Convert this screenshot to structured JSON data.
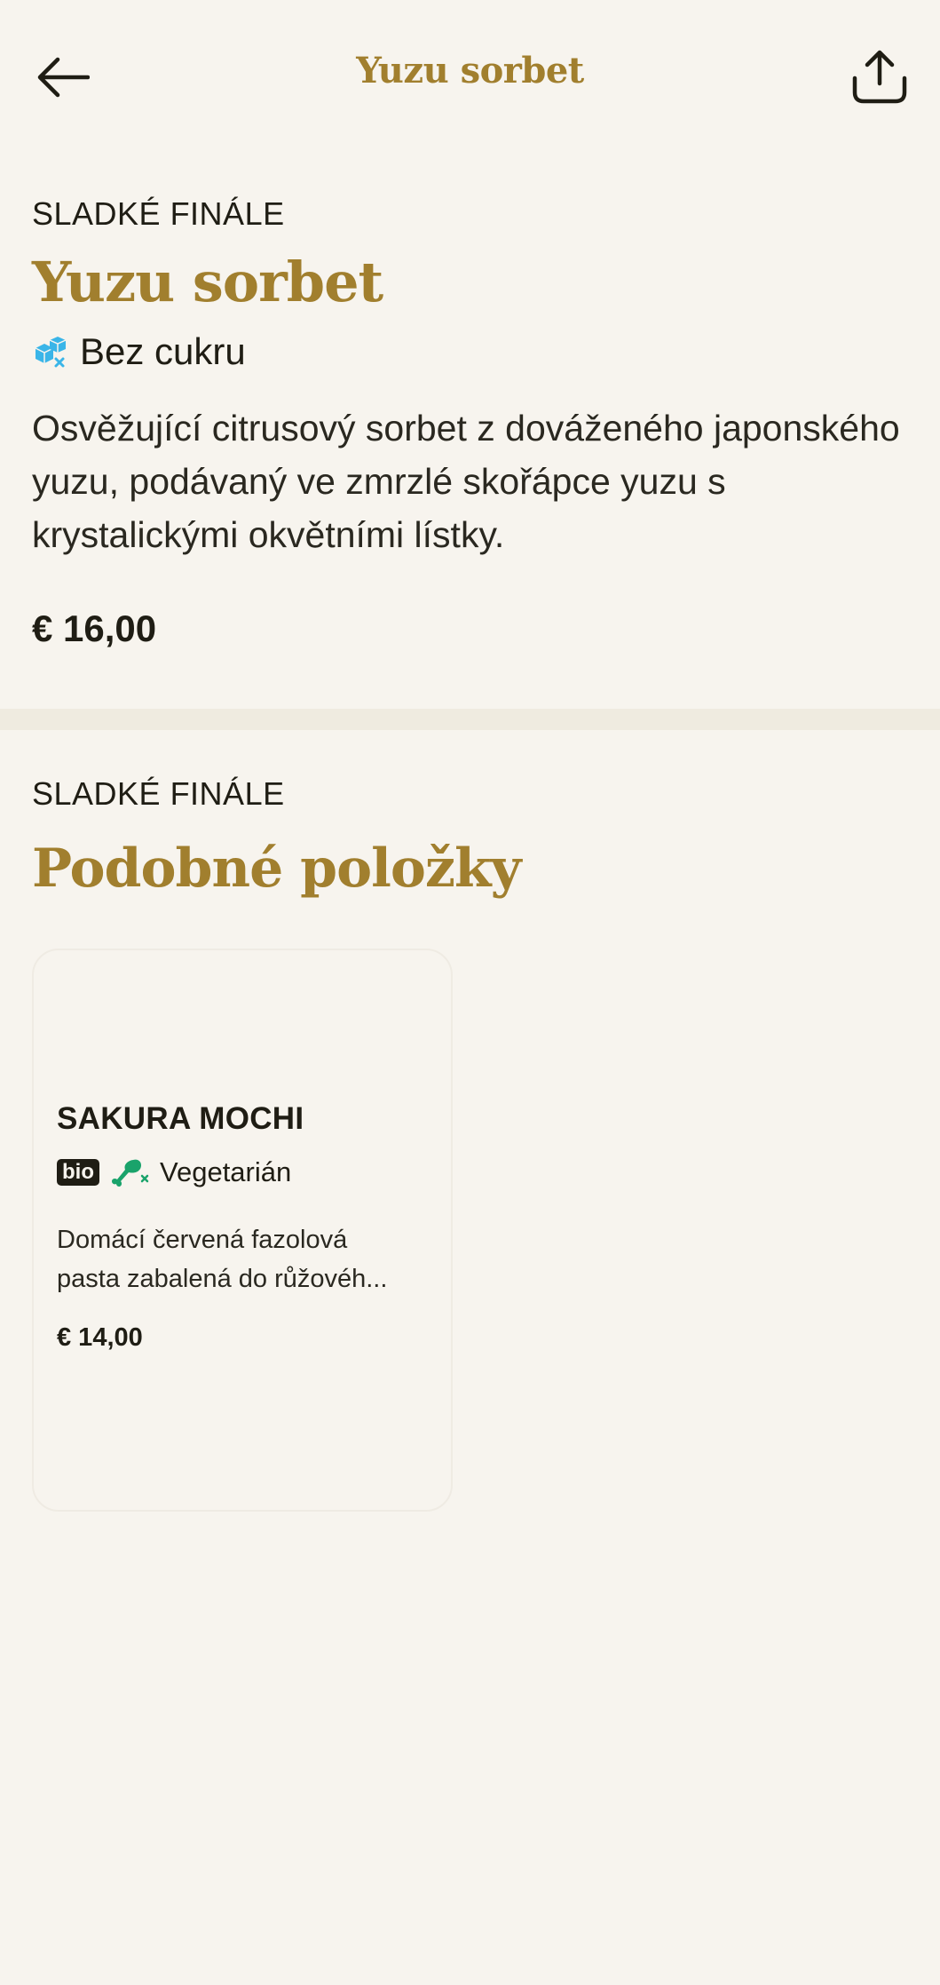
{
  "header": {
    "title": "Yuzu sorbet",
    "back_icon": "arrow-left-icon",
    "share_icon": "share-icon"
  },
  "item": {
    "category": "SLADKÉ FINÁLE",
    "name": "Yuzu sorbet",
    "tag_icon": "sugar-free-icon",
    "tag_label": "Bez cukru",
    "description": "Osvěžující citrusový sorbet z dováženého japonského yuzu, podávaný ve zmrzlé skořápce yuzu s krystalickými okvětními lístky.",
    "price": "€ 16,00"
  },
  "similar": {
    "category": "SLADKÉ FINÁLE",
    "title": "Podobné položky",
    "items": [
      {
        "name": "SAKURA MOCHI",
        "badge": "bio",
        "tag_icon": "no-meat-icon",
        "tag_label": "Vegetarián",
        "description_line1": "Domácí červená fazolová",
        "description_line2": "pasta zabalená do růžovéh...",
        "price": "€ 14,00"
      }
    ]
  },
  "colors": {
    "background": "#f7f4ee",
    "accent": "#a17f2e",
    "text": "#1f1d14",
    "sugar_free_icon": "#3ab5e8",
    "vegetarian_icon": "#1aa36b"
  }
}
